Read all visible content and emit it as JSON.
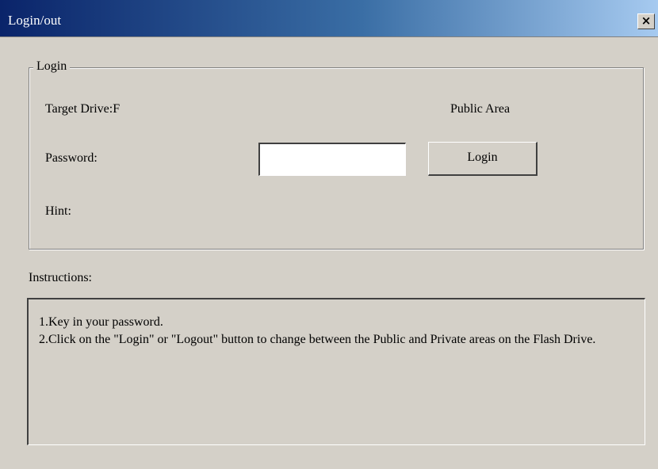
{
  "window": {
    "title": "Login/out",
    "close_glyph": "×",
    "close_icon": "close-icon"
  },
  "login_group": {
    "legend": "Login",
    "target_drive_label": "Target Drive:F",
    "area_status": "Public Area",
    "password_label": "Password:",
    "password_value": "",
    "login_button_label": "Login",
    "hint_label": "Hint:"
  },
  "instructions": {
    "label": "Instructions:",
    "lines": [
      "1.Key in your password.",
      "2.Click on the \"Login\" or \"Logout\" button to change between the Public and Private areas on the Flash Drive."
    ]
  },
  "colors": {
    "titlebar_start": "#0a246a",
    "titlebar_end": "#a6caf0",
    "dialog_face": "#d4d0c8"
  }
}
